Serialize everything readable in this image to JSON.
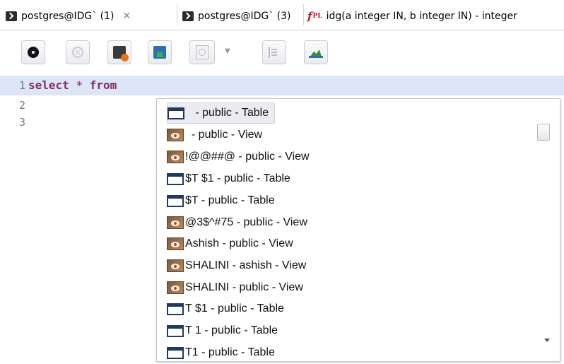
{
  "tabs": [
    {
      "label": "postgres@IDG` (1)",
      "icon": "terminal-icon",
      "active": true,
      "close": "✕"
    },
    {
      "label": "postgres@IDG` (3)",
      "icon": "terminal-icon",
      "active": false
    },
    {
      "label": "idg(a integer IN, b integer IN) - integer",
      "icon": "function-icon",
      "icon_text": "f",
      "icon_sub": "PL",
      "active": false
    }
  ],
  "toolbar": {
    "buttons": [
      "execute-icon",
      "stop-icon",
      "explain-icon",
      "save-results-icon",
      "history-icon",
      "format-icon",
      "explain-plan-icon"
    ],
    "dropdown_glyph": "▼"
  },
  "editor": {
    "lines": [
      {
        "num": "1",
        "tokens": [
          {
            "t": "select",
            "c": "kw"
          },
          {
            "t": " ",
            "c": ""
          },
          {
            "t": "*",
            "c": "op"
          },
          {
            "t": " ",
            "c": ""
          },
          {
            "t": "from",
            "c": "kw"
          }
        ]
      },
      {
        "num": "2"
      },
      {
        "num": "3"
      }
    ],
    "current_line_color": "#dde6f6"
  },
  "autocomplete": {
    "items": [
      {
        "label": "   - public - Table",
        "icon": "table-icon",
        "selected": true
      },
      {
        "label": "  - public - View",
        "icon": "view-icon"
      },
      {
        "label": "!@@##@ - public - View",
        "icon": "view-icon"
      },
      {
        "label": "$T $1 - public - Table",
        "icon": "table-icon"
      },
      {
        "label": "$T - public - Table",
        "icon": "table-icon"
      },
      {
        "label": "@3$^#75 - public - View",
        "icon": "view-icon"
      },
      {
        "label": "Ashish - public - View",
        "icon": "view-icon"
      },
      {
        "label": "SHALINI - ashish - View",
        "icon": "view-icon"
      },
      {
        "label": "SHALINI - public - View",
        "icon": "view-icon"
      },
      {
        "label": "T $1 - public - Table",
        "icon": "table-icon"
      },
      {
        "label": "T 1 - public - Table",
        "icon": "table-icon"
      },
      {
        "label": "T1 - public - Table",
        "icon": "table-icon"
      }
    ]
  }
}
